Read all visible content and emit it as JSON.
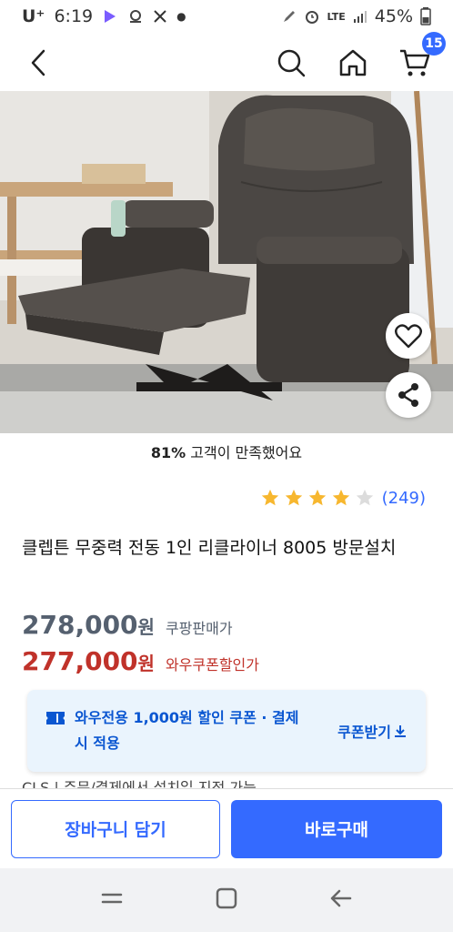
{
  "status_bar": {
    "carrier": "U⁺",
    "time": "6:19",
    "network": "LTE",
    "battery": "45%"
  },
  "header": {
    "cart_count": "15"
  },
  "product": {
    "satisfaction_pct": "81%",
    "satisfaction_text": " 고객이 만족했어요",
    "rating_stars": 4,
    "rating_max": 5,
    "review_count": "(249)",
    "title": "클렙튼 무중력 전동 1인 리클라이너 8005 방문설치",
    "price_original": "278,000",
    "price_original_unit": "원",
    "price_original_label": "쿠팡판매가",
    "price_discount": "277,000",
    "price_discount_unit": "원",
    "price_discount_label": "와우쿠폰할인가"
  },
  "coupon": {
    "text": "와우전용 1,000원 할인 쿠폰 · 결제 시 적용",
    "button_label": "쿠폰받기"
  },
  "cut_text": "CLS | 주문/결제에서 설치일 지정 가능",
  "actions": {
    "add_to_cart": "장바구니 담기",
    "buy_now": "바로구매"
  },
  "colors": {
    "accent": "#346aff",
    "discount_red": "#c0322a",
    "star_gold": "#f7b72f"
  }
}
